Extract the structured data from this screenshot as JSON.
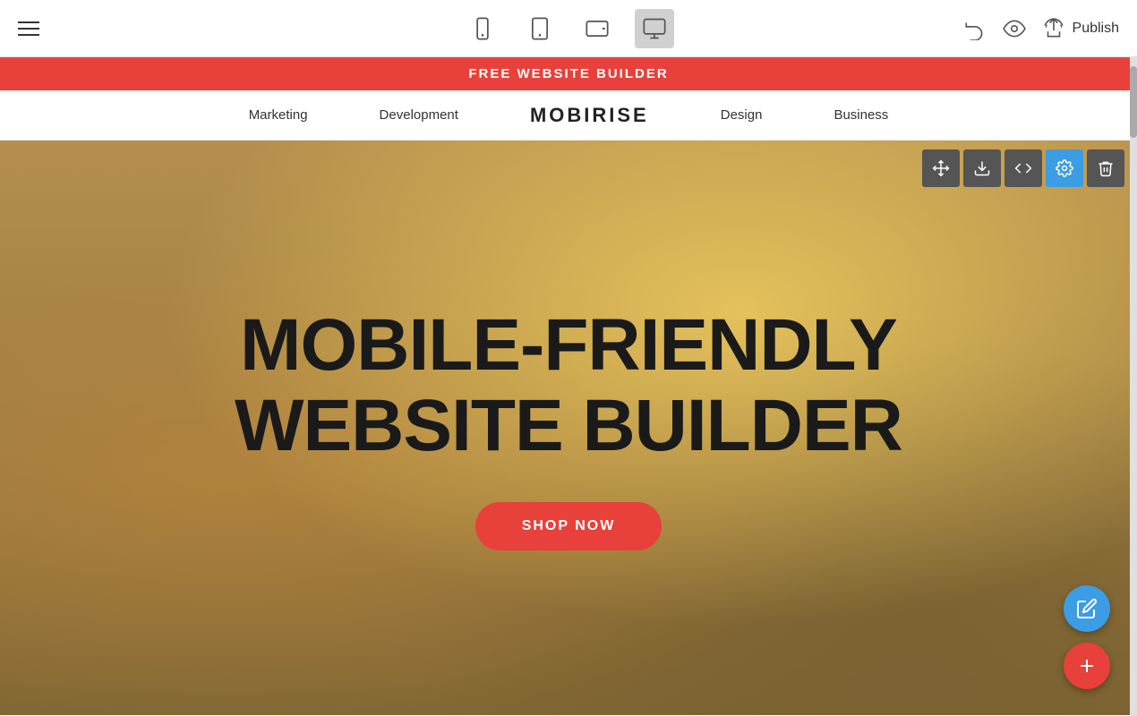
{
  "toolbar": {
    "hamburger_label": "menu",
    "devices": [
      {
        "id": "mobile",
        "label": "Mobile view",
        "active": false
      },
      {
        "id": "tablet",
        "label": "Tablet view",
        "active": false
      },
      {
        "id": "tablet-landscape",
        "label": "Tablet landscape view",
        "active": false
      },
      {
        "id": "desktop",
        "label": "Desktop view",
        "active": true
      }
    ],
    "undo_label": "Undo",
    "preview_label": "Preview",
    "publish_label": "Publish"
  },
  "banner": {
    "text": "FREE WEBSITE BUILDER"
  },
  "nav": {
    "logo": "MOBIRISE",
    "links": [
      "Marketing",
      "Development",
      "Design",
      "Business"
    ]
  },
  "hero": {
    "title_line1": "MOBILE-FRIENDLY",
    "title_line2": "WEBSITE BUILDER",
    "cta_label": "SHOP NOW"
  },
  "block_controls": [
    {
      "id": "move",
      "label": "Move block"
    },
    {
      "id": "download",
      "label": "Save block"
    },
    {
      "id": "code",
      "label": "Edit code"
    },
    {
      "id": "settings",
      "label": "Block settings",
      "active": true
    },
    {
      "id": "delete",
      "label": "Delete block"
    }
  ],
  "fabs": [
    {
      "id": "edit",
      "label": "Edit"
    },
    {
      "id": "add",
      "label": "Add block"
    }
  ],
  "colors": {
    "red": "#e8403a",
    "blue": "#3b9de4",
    "dark": "#1a1a1a",
    "toolbar_bg": "#ffffff"
  }
}
